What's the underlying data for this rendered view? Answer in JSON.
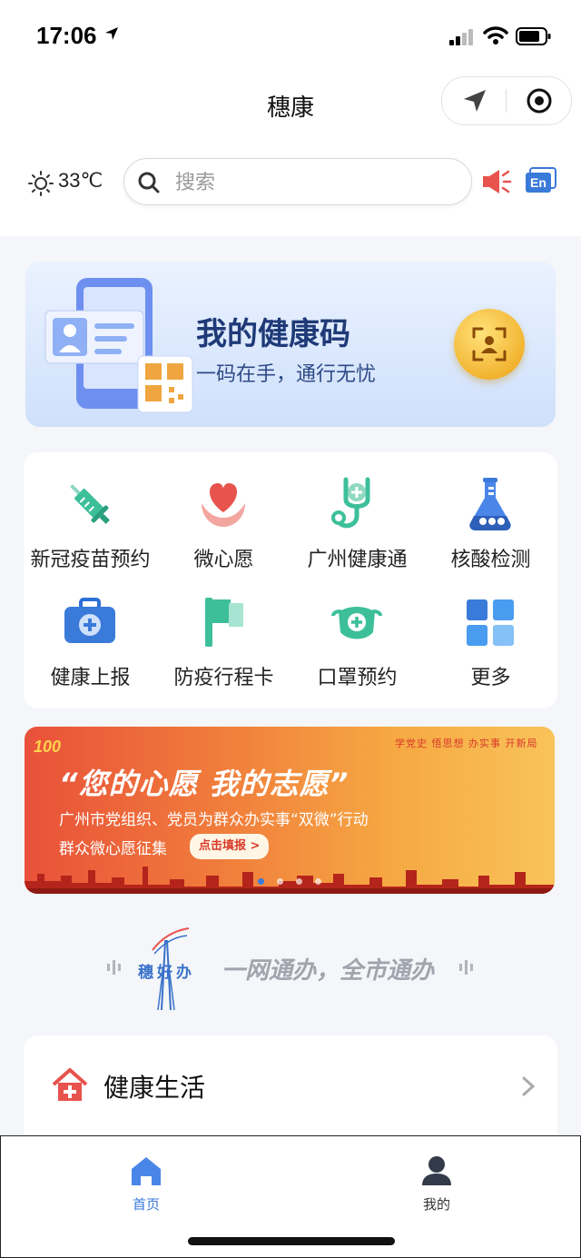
{
  "status": {
    "time": "17:06"
  },
  "nav": {
    "title": "穗康"
  },
  "weather": {
    "temperature": "33℃"
  },
  "search": {
    "placeholder": "搜索"
  },
  "health_code": {
    "title": "我的健康码",
    "subtitle": "一码在手，通行无忧"
  },
  "services": [
    {
      "label": "新冠疫苗预约",
      "icon": "vaccine-syringe-icon"
    },
    {
      "label": "微心愿",
      "icon": "heart-hands-icon"
    },
    {
      "label": "广州健康通",
      "icon": "stethoscope-icon"
    },
    {
      "label": "核酸检测",
      "icon": "test-flask-icon"
    },
    {
      "label": "健康上报",
      "icon": "medical-kit-icon"
    },
    {
      "label": "防疫行程卡",
      "icon": "flag-icon"
    },
    {
      "label": "口罩预约",
      "icon": "mask-icon"
    },
    {
      "label": "更多",
      "icon": "grid-more-icon"
    }
  ],
  "banner": {
    "badge": "100",
    "title": "“您的心愿 我的志愿”",
    "line1": "广州市党组织、党员为群众办实事“双微”行动",
    "line2": "群众微心愿征集",
    "button": "点击填报 >",
    "top_tags": "学党史 悟思想 办实事 开新局",
    "active_slide": 0,
    "slide_count": 4
  },
  "slogan": {
    "brand": "穗好办",
    "text": "一网通办，全市通办"
  },
  "health_life": {
    "title": "健康生活"
  },
  "tabbar": {
    "home": "首页",
    "mine": "我的"
  },
  "colors": {
    "accent_blue": "#3a7ad9",
    "card_title": "#1f3a77",
    "banner_red": "#e9513a",
    "icon_green": "#3dbf9a",
    "icon_red": "#e8534d"
  }
}
